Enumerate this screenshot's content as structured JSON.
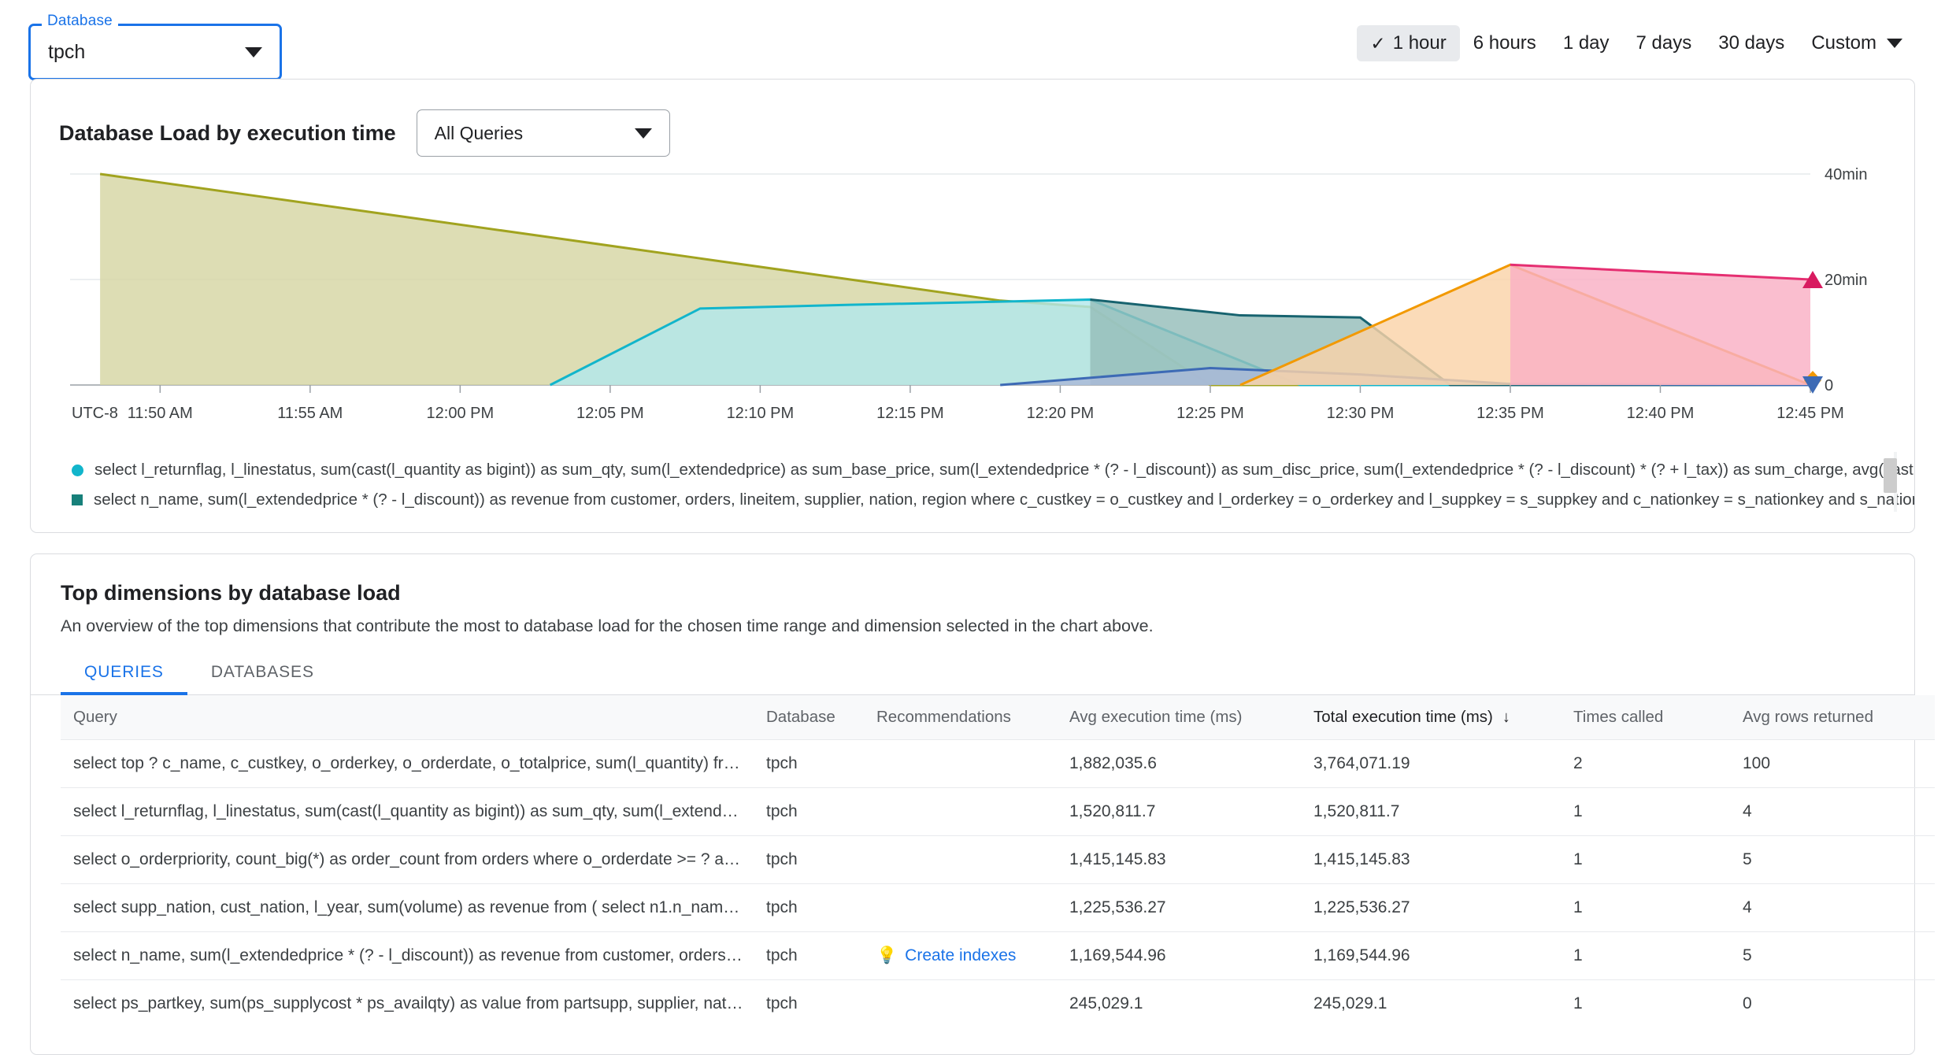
{
  "database_selector": {
    "label": "Database",
    "value": "tpch",
    "caret_icon": "chevron-down-icon"
  },
  "time_range": {
    "options": [
      {
        "label": "1 hour",
        "selected": true
      },
      {
        "label": "6 hours",
        "selected": false
      },
      {
        "label": "1 day",
        "selected": false
      },
      {
        "label": "7 days",
        "selected": false
      },
      {
        "label": "30 days",
        "selected": false
      }
    ],
    "custom_label": "Custom",
    "check_icon": "check-icon",
    "caret_icon": "chevron-down-icon"
  },
  "chart_card": {
    "title": "Database Load by execution time",
    "query_filter": "All Queries"
  },
  "chart_data": {
    "type": "area",
    "title": "Database Load by execution time",
    "xlabel": "",
    "ylabel": "",
    "timezone_label": "UTC-8",
    "grid": true,
    "legend_position": "bottom",
    "ylim": [
      0,
      40
    ],
    "yunit": "min",
    "yticks": [
      0,
      20,
      40
    ],
    "ytick_labels": [
      "0",
      "20min",
      "40min"
    ],
    "xticks": [
      "11:50 AM",
      "11:55 AM",
      "12:00 PM",
      "12:05 PM",
      "12:10 PM",
      "12:15 PM",
      "12:20 PM",
      "12:25 PM",
      "12:30 PM",
      "12:35 PM",
      "12:40 PM",
      "12:45 PM"
    ],
    "x_minutes": [
      710,
      715,
      720,
      725,
      730,
      735,
      740,
      745,
      750,
      755,
      760,
      765
    ],
    "xlim": [
      707,
      765
    ],
    "series": [
      {
        "name": "olive",
        "color": "#a1a31f",
        "fill": "#d6d5a4",
        "x": [
          708,
          713,
          718,
          723,
          728,
          733,
          738,
          741,
          745,
          750,
          765
        ],
        "values": [
          40.0,
          36.0,
          32.0,
          28.0,
          24.0,
          20.0,
          16.0,
          14.8,
          0,
          0,
          0
        ]
      },
      {
        "name": "cyan",
        "color": "#12b5cb",
        "fill": "#b2e8ec",
        "x": [
          723,
          728,
          733,
          738,
          741,
          748,
          765
        ],
        "values": [
          0,
          14.5,
          15.2,
          15.8,
          16.2,
          0,
          0
        ]
      },
      {
        "name": "teal",
        "color": "#17636f",
        "fill": "#95bdb9",
        "x": [
          741,
          746,
          750,
          753,
          765
        ],
        "values": [
          16.2,
          13.2,
          12.8,
          0,
          0
        ]
      },
      {
        "name": "blue",
        "color": "#3d6ab5",
        "fill": "#aab8d8",
        "x": [
          738,
          745,
          750,
          755,
          765
        ],
        "values": [
          0,
          3.2,
          2.0,
          0.2,
          0
        ]
      },
      {
        "name": "orange",
        "color": "#f29900",
        "fill": "#fad3a8",
        "x": [
          746,
          755,
          765
        ],
        "values": [
          0,
          22.8,
          0
        ]
      },
      {
        "name": "pink",
        "color": "#e52e71",
        "fill": "#f9b0c5",
        "x": [
          755,
          765
        ],
        "values": [
          22.8,
          20.0
        ]
      }
    ],
    "edge_markers": [
      {
        "shape": "triangle-up",
        "color": "#d81b60",
        "label": "20min",
        "value": 20
      },
      {
        "shape": "diamond",
        "color": "#f29900",
        "label": "",
        "value": 0.9
      },
      {
        "shape": "triangle-down",
        "color": "#3d6ab5",
        "label": "0",
        "value": 0
      }
    ],
    "legend": [
      {
        "marker": "circle",
        "color": "#12b5cb",
        "text": "select l_returnflag, l_linestatus, sum(cast(l_quantity as bigint)) as sum_qty, sum(l_extendedprice) as sum_base_price, sum(l_extendedprice * (? - l_discount)) as sum_disc_price, sum(l_extendedprice * (? - l_discount) * (? + l_tax)) as sum_charge, avg(cast(l_quantity as …"
      },
      {
        "marker": "square",
        "color": "#17807a",
        "text": "select n_name, sum(l_extendedprice * (? - l_discount)) as revenue from customer, orders, lineitem, supplier, nation, region where c_custkey = o_custkey and l_orderkey = o_orderkey and l_suppkey = s_suppkey and c_nationkey = s_nationkey and s_nationkey = n_nation…"
      }
    ]
  },
  "dimensions": {
    "title": "Top dimensions by database load",
    "subtitle": "An overview of the top dimensions that contribute the most to database load for the chosen time range and dimension selected in the chart above.",
    "tabs": [
      {
        "label": "QUERIES",
        "active": true
      },
      {
        "label": "DATABASES",
        "active": false
      }
    ],
    "columns": [
      "Query",
      "Database",
      "Recommendations",
      "Avg execution time (ms)",
      "Total execution time (ms)",
      "Times called",
      "Avg rows returned"
    ],
    "sort_column": "Total execution time (ms)",
    "sort_arrow": "arrow-down-icon",
    "rows": [
      {
        "query": "select top ? c_name, c_custkey, o_orderkey, o_orderdate, o_totalprice, sum(l_quantity) fro…",
        "database": "tpch",
        "recommendation": "",
        "avg_execution_time": "1,882,035.6",
        "total_execution_time": "3,764,071.19",
        "times_called": "2",
        "avg_rows_returned": "100"
      },
      {
        "query": "select l_returnflag, l_linestatus, sum(cast(l_quantity as bigint)) as sum_qty, sum(l_extend…",
        "database": "tpch",
        "recommendation": "",
        "avg_execution_time": "1,520,811.7",
        "total_execution_time": "1,520,811.7",
        "times_called": "1",
        "avg_rows_returned": "4"
      },
      {
        "query": "select o_orderpriority, count_big(*) as order_count from orders where o_orderdate >= ? a…",
        "database": "tpch",
        "recommendation": "",
        "avg_execution_time": "1,415,145.83",
        "total_execution_time": "1,415,145.83",
        "times_called": "1",
        "avg_rows_returned": "5"
      },
      {
        "query": "select supp_nation, cust_nation, l_year, sum(volume) as revenue from ( select n1.n_name…",
        "database": "tpch",
        "recommendation": "",
        "avg_execution_time": "1,225,536.27",
        "total_execution_time": "1,225,536.27",
        "times_called": "1",
        "avg_rows_returned": "4"
      },
      {
        "query": "select n_name, sum(l_extendedprice * (? - l_discount)) as revenue from customer, orders,…",
        "database": "tpch",
        "recommendation": "Create indexes",
        "avg_execution_time": "1,169,544.96",
        "total_execution_time": "1,169,544.96",
        "times_called": "1",
        "avg_rows_returned": "5"
      },
      {
        "query": "select ps_partkey, sum(ps_supplycost * ps_availqty) as value from partsupp, supplier, nat…",
        "database": "tpch",
        "recommendation": "",
        "avg_execution_time": "245,029.1",
        "total_execution_time": "245,029.1",
        "times_called": "1",
        "avg_rows_returned": "0"
      }
    ]
  }
}
